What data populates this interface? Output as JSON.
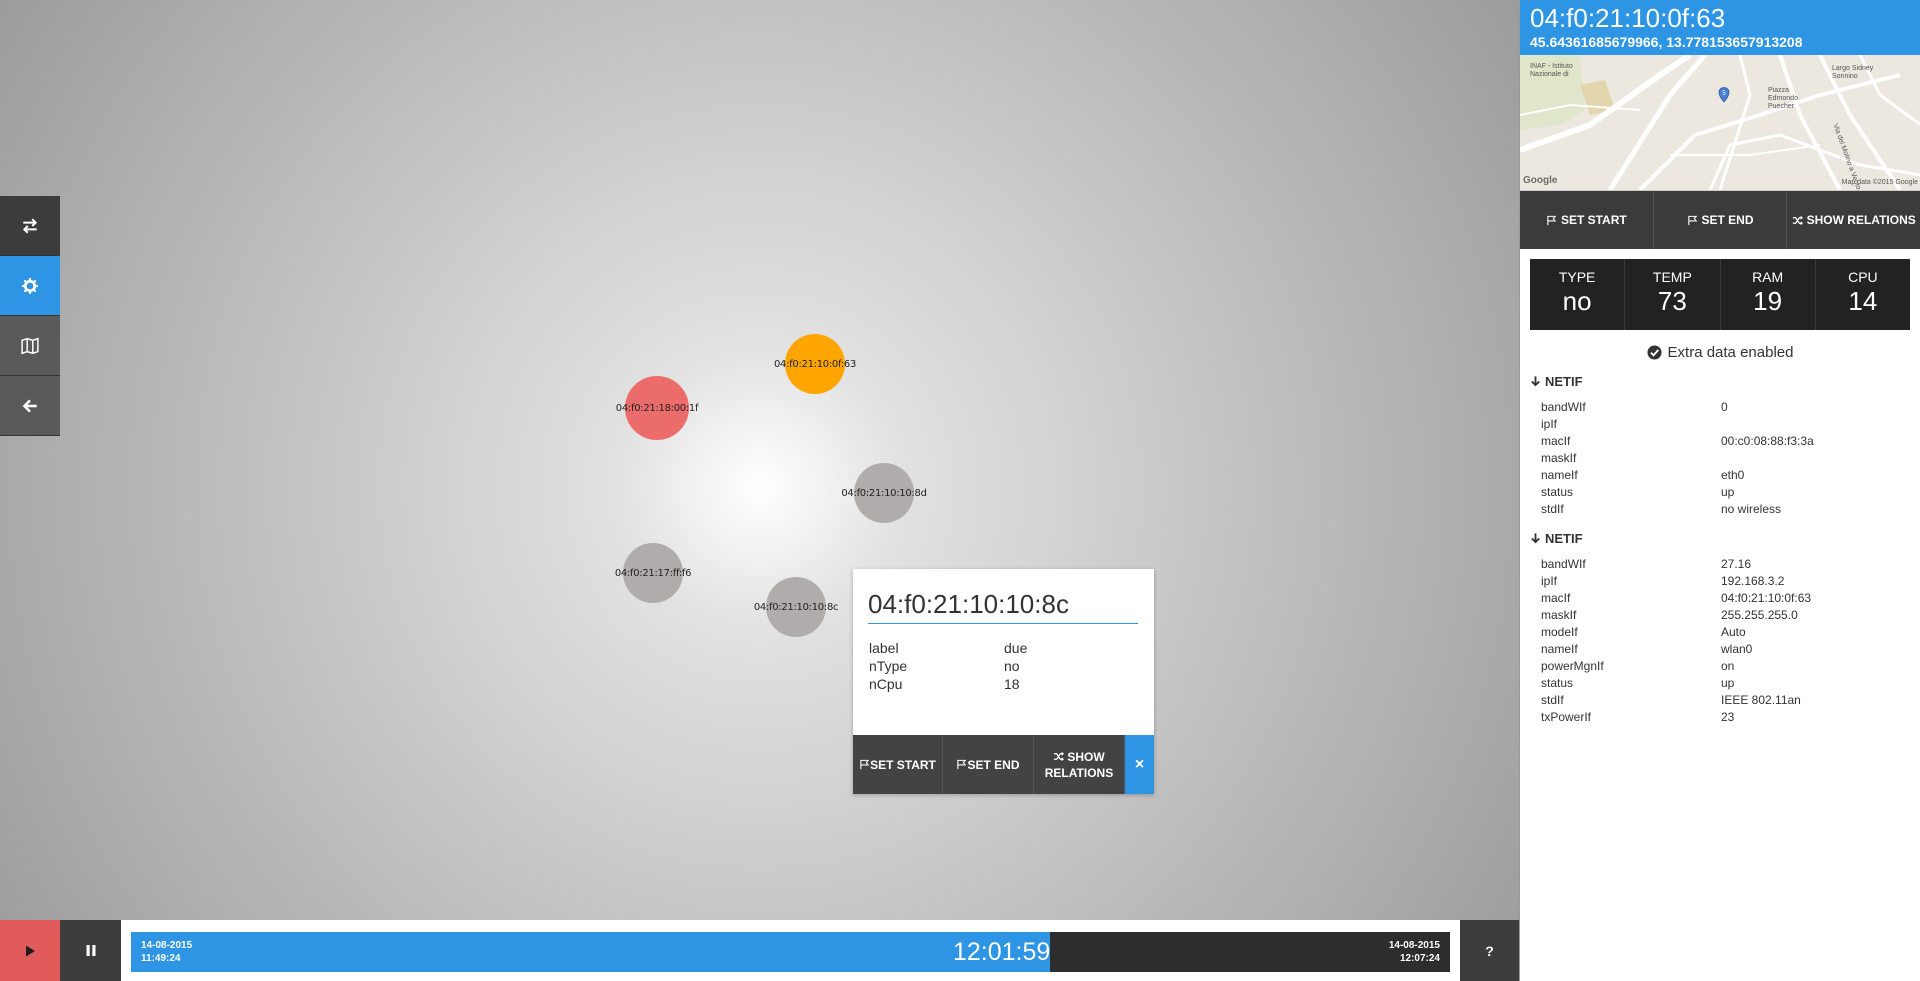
{
  "left_toolbar": {
    "items": [
      {
        "icon": "swap-arrows-icon"
      },
      {
        "icon": "gear-icon",
        "active": true
      },
      {
        "icon": "map-icon"
      },
      {
        "icon": "arrow-left-icon"
      }
    ]
  },
  "graph": {
    "nodes": [
      {
        "label": "04:f0:21:10:0f:63",
        "color": "#ffa500",
        "state": "selected"
      },
      {
        "label": "04:f0:21:18:00:1f",
        "color": "#ec6b6b",
        "state": "highlighted"
      },
      {
        "label": "04:f0:21:10:10:8d",
        "color": "#b0acab",
        "state": "normal"
      },
      {
        "label": "04:f0:21:17:ff:f6",
        "color": "#b0acab",
        "state": "normal"
      },
      {
        "label": "04:f0:21:10:10:8c",
        "color": "#b0acab",
        "state": "normal"
      }
    ]
  },
  "popup": {
    "title": "04:f0:21:10:10:8c",
    "props": [
      {
        "k": "label",
        "v": "due"
      },
      {
        "k": "nType",
        "v": "no"
      },
      {
        "k": "nCpu",
        "v": "18"
      }
    ],
    "set_start": "SET START",
    "set_end": "SET END",
    "show_relations_1": "SHOW",
    "show_relations_2": "RELATIONS",
    "close": "×"
  },
  "panel": {
    "title": "04:f0:21:10:0f:63",
    "coords": "45.64361685679966, 13.778153657913208",
    "map": {
      "labels": [
        "INAF - Istituto",
        "Nazionale di",
        "Largo Sidney",
        "Sonnino",
        "Piazza",
        "Edmondo",
        "Puecher",
        "Via del Molino a Vento"
      ],
      "google": "Google",
      "attribution": "Map data ©2015 Google"
    },
    "set_start": "SET START",
    "set_end": "SET END",
    "show_relations": "SHOW RELATIONS",
    "stats": [
      {
        "label": "TYPE",
        "value": "no"
      },
      {
        "label": "TEMP",
        "value": "73"
      },
      {
        "label": "RAM",
        "value": "19"
      },
      {
        "label": "CPU",
        "value": "14"
      }
    ],
    "extra": "Extra data enabled",
    "netif": [
      {
        "title": "NETIF",
        "rows": [
          {
            "k": "bandWIf",
            "v": "0"
          },
          {
            "k": "ipIf",
            "v": ""
          },
          {
            "k": "macIf",
            "v": "00:c0:08:88:f3:3a"
          },
          {
            "k": "maskIf",
            "v": ""
          },
          {
            "k": "nameIf",
            "v": "eth0"
          },
          {
            "k": "status",
            "v": "up"
          },
          {
            "k": "stdIf",
            "v": "no wireless"
          }
        ]
      },
      {
        "title": "NETIF",
        "rows": [
          {
            "k": "bandWIf",
            "v": "27.16"
          },
          {
            "k": "ipIf",
            "v": "192.168.3.2"
          },
          {
            "k": "macIf",
            "v": "04:f0:21:10:0f:63"
          },
          {
            "k": "maskIf",
            "v": "255.255.255.0"
          },
          {
            "k": "modeIf",
            "v": "Auto"
          },
          {
            "k": "nameIf",
            "v": "wlan0"
          },
          {
            "k": "powerMgnIf",
            "v": "on"
          },
          {
            "k": "status",
            "v": "up"
          },
          {
            "k": "stdIf",
            "v": "IEEE 802.11an"
          },
          {
            "k": "txPowerIf",
            "v": "23"
          }
        ]
      }
    ]
  },
  "timeline": {
    "start_date": "14-08-2015",
    "start_time": "11:49:24",
    "end_date": "14-08-2015",
    "end_time": "12:07:24",
    "current": "12:01:59",
    "progress": 0.697,
    "help": "?"
  },
  "colors": {
    "accent": "#2d95e3",
    "play": "#e25b5b",
    "dark": "#3c3c3c"
  }
}
